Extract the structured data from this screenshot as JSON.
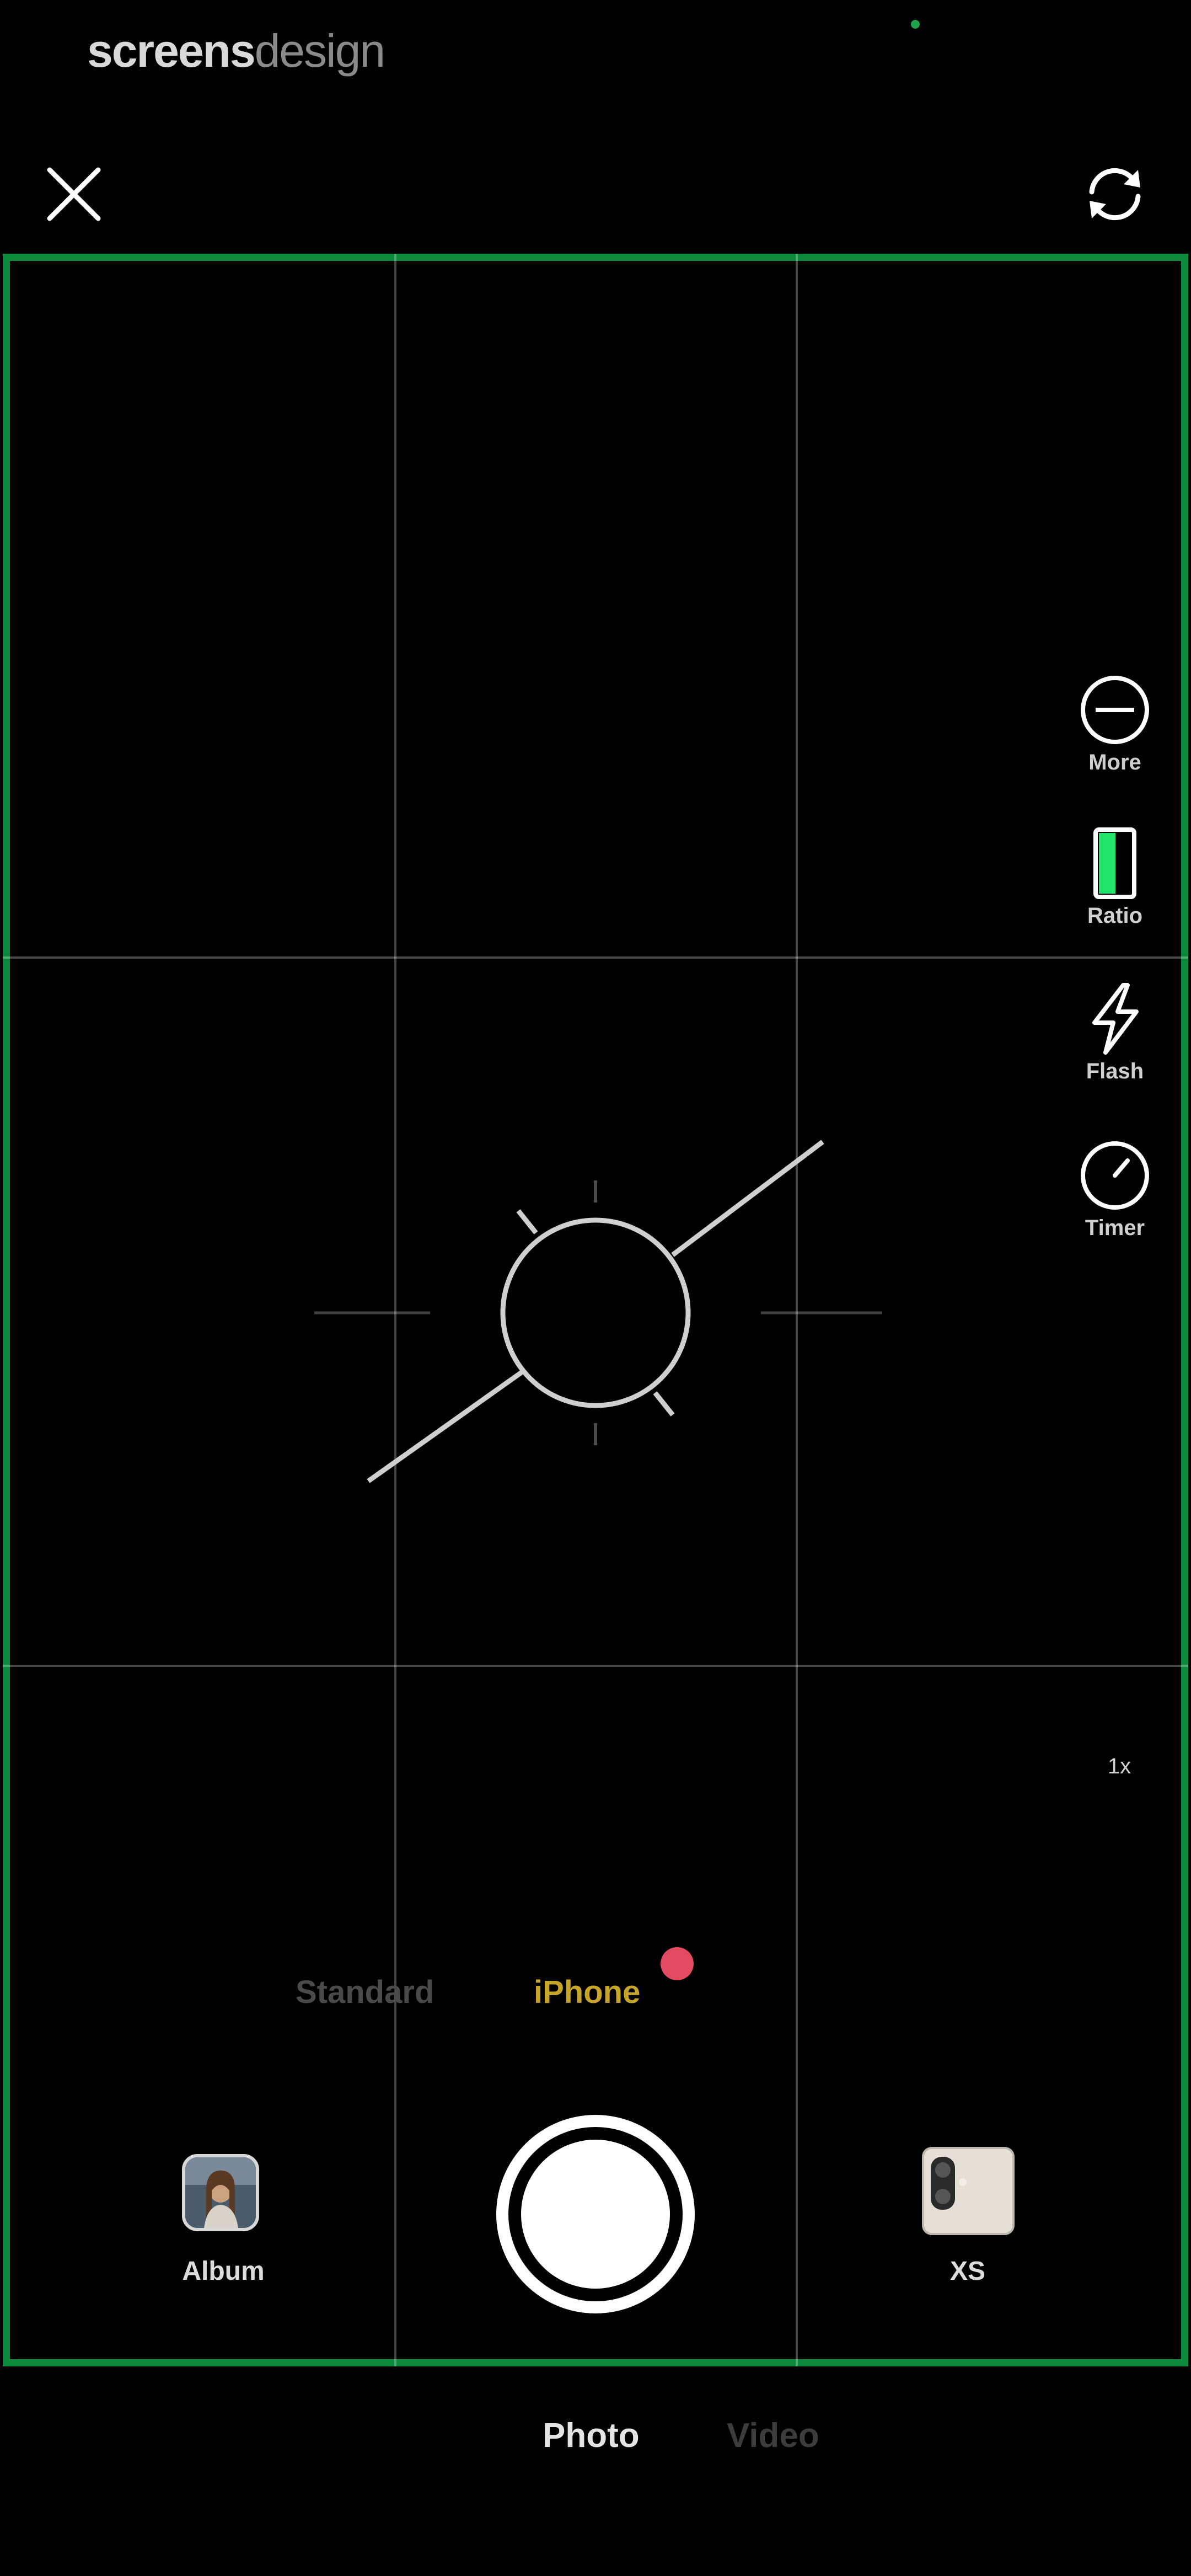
{
  "watermark": {
    "part1": "screens",
    "part2": "design"
  },
  "header": {
    "close_icon": "close-icon",
    "flip_icon": "flip-camera-icon"
  },
  "tools": {
    "more": {
      "label": "More",
      "icon": "more-circle-icon"
    },
    "ratio": {
      "label": "Ratio",
      "icon": "ratio-icon"
    },
    "flash": {
      "label": "Flash",
      "icon": "flash-icon"
    },
    "timer": {
      "label": "Timer",
      "icon": "timer-icon"
    }
  },
  "zoom": "1x",
  "modes": {
    "standard": "Standard",
    "iphone": "iPhone"
  },
  "bottom": {
    "album_label": "Album",
    "device_label": "XS"
  },
  "capture_modes": {
    "photo": "Photo",
    "video": "Video"
  },
  "colors": {
    "viewfinder_border": "#0c8a3b",
    "active_mode": "#c7a528",
    "badge": "#e44a62",
    "ratio_fill": "#22e36b"
  }
}
